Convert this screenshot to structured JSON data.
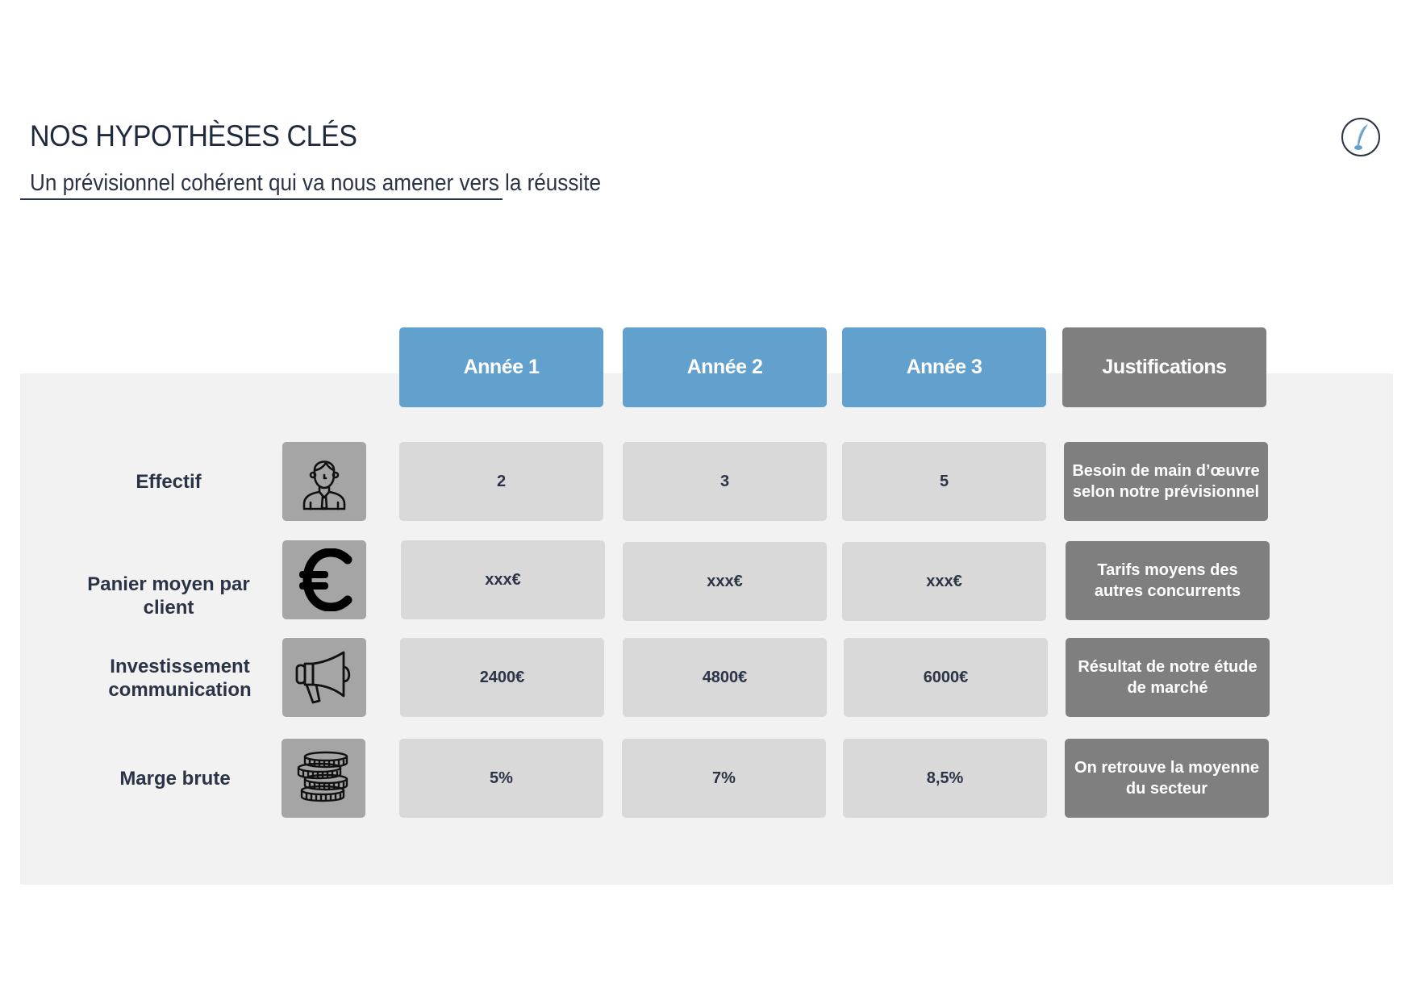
{
  "header": {
    "title": "NOS HYPOTHÈSES CLÉS",
    "subtitle": "Un prévisionnel cohérent qui va nous amener vers la réussite",
    "logo_icon": "quill-pen-icon"
  },
  "colors": {
    "year_header": "#62a0cd",
    "justification": "#7f7f7f",
    "cell": "#d9d9d9",
    "icon_box": "#a5a5a5",
    "band": "#f2f2f2",
    "text_dark": "#2b3347"
  },
  "table": {
    "columns": [
      "Année 1",
      "Année 2",
      "Année 3",
      "Justifications"
    ],
    "rows": [
      {
        "label": "Effectif",
        "icon": "employee-icon",
        "values": [
          "2",
          "3",
          "5"
        ],
        "justification": "Besoin de main d’œuvre selon notre prévisionnel"
      },
      {
        "label": "Panier moyen par client",
        "icon": "euro-icon",
        "values": [
          "xxx€",
          "xxx€",
          "xxx€"
        ],
        "justification": "Tarifs moyens des autres concurrents"
      },
      {
        "label": "Investissement communication",
        "icon": "megaphone-icon",
        "values": [
          "2400€",
          "4800€",
          "6000€"
        ],
        "justification": "Résultat de notre étude de marché"
      },
      {
        "label": "Marge brute",
        "icon": "coins-stack-icon",
        "values": [
          "5%",
          "7%",
          "8,5%"
        ],
        "justification": "On retrouve la moyenne du secteur"
      }
    ]
  }
}
